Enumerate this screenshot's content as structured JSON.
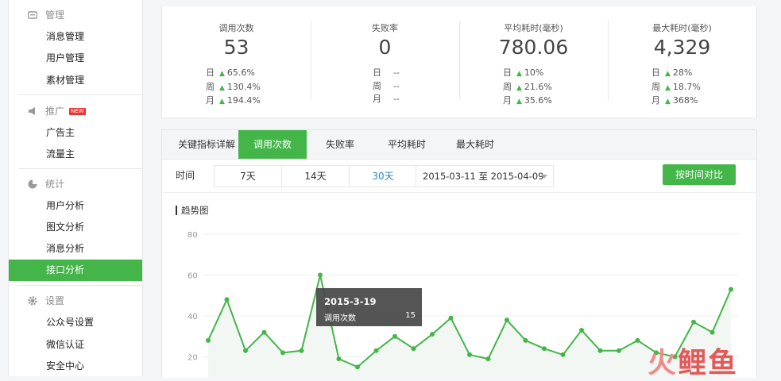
{
  "sidebar": {
    "sections": [
      {
        "icon": "management-icon",
        "title": "管理",
        "items": [
          {
            "label": "消息管理"
          },
          {
            "label": "用户管理"
          },
          {
            "label": "素材管理"
          }
        ]
      },
      {
        "icon": "megaphone-icon",
        "title": "推广",
        "badge": "NEW",
        "items": [
          {
            "label": "广告主"
          },
          {
            "label": "流量主"
          }
        ]
      },
      {
        "icon": "statistics-icon",
        "title": "统计",
        "items": [
          {
            "label": "用户分析"
          },
          {
            "label": "图文分析"
          },
          {
            "label": "消息分析"
          },
          {
            "label": "接口分析",
            "active": true
          }
        ]
      },
      {
        "icon": "settings-icon",
        "title": "设置",
        "items": [
          {
            "label": "公众号设置"
          },
          {
            "label": "微信认证"
          },
          {
            "label": "安全中心"
          }
        ]
      }
    ]
  },
  "stats": [
    {
      "title": "调用次数",
      "value": "53",
      "rows": [
        {
          "label": "日",
          "change": "65.6%"
        },
        {
          "label": "周",
          "change": "130.4%"
        },
        {
          "label": "月",
          "change": "194.4%"
        }
      ]
    },
    {
      "title": "失败率",
      "value": "0",
      "rows": [
        {
          "label": "日",
          "change": "--"
        },
        {
          "label": "周",
          "change": "--"
        },
        {
          "label": "月",
          "change": "--"
        }
      ]
    },
    {
      "title": "平均耗时(毫秒)",
      "value": "780.06",
      "rows": [
        {
          "label": "日",
          "change": "10%"
        },
        {
          "label": "周",
          "change": "21.6%"
        },
        {
          "label": "月",
          "change": "35.6%"
        }
      ]
    },
    {
      "title": "最大耗时(毫秒)",
      "value": "4,329",
      "rows": [
        {
          "label": "日",
          "change": "28%"
        },
        {
          "label": "周",
          "change": "18.7%"
        },
        {
          "label": "月",
          "change": "368%"
        }
      ]
    }
  ],
  "tabs": [
    {
      "label": "关键指标详解"
    },
    {
      "label": "调用次数",
      "active": true
    },
    {
      "label": "失败率"
    },
    {
      "label": "平均耗时"
    },
    {
      "label": "最大耗时"
    }
  ],
  "filter": {
    "time_label": "时间",
    "ranges": [
      {
        "label": "7天"
      },
      {
        "label": "14天"
      },
      {
        "label": "30天",
        "selected": true
      }
    ],
    "date_range": "2015-03-11 至 2015-04-09",
    "compare_label": "按时间对比"
  },
  "trend_title": "趋势图",
  "tooltip": {
    "date": "2015-3-19",
    "series": "调用次数",
    "value": "15"
  },
  "chart_data": {
    "type": "area",
    "ylim": [
      0,
      80
    ],
    "yticks": [
      20,
      40,
      60,
      80
    ],
    "x_range": [
      "2015-03-11",
      "2015-04-09"
    ],
    "x": [
      "2015-03-11",
      "2015-03-12",
      "2015-03-13",
      "2015-03-14",
      "2015-03-15",
      "2015-03-16",
      "2015-03-17",
      "2015-03-18",
      "2015-03-19",
      "2015-03-20",
      "2015-03-21",
      "2015-03-22",
      "2015-03-23",
      "2015-03-24",
      "2015-03-25",
      "2015-03-26",
      "2015-03-27",
      "2015-03-28",
      "2015-03-29",
      "2015-03-30",
      "2015-03-31",
      "2015-04-01",
      "2015-04-02",
      "2015-04-03",
      "2015-04-04",
      "2015-04-05",
      "2015-04-06",
      "2015-04-07",
      "2015-04-08",
      "2015-04-09"
    ],
    "series": [
      {
        "values": [
          28,
          48,
          23,
          32,
          22,
          23,
          60,
          19,
          15,
          23,
          30,
          24,
          31,
          39,
          21,
          19,
          38,
          28,
          24,
          21,
          33,
          23,
          23,
          28,
          22,
          20,
          37,
          32,
          53
        ]
      }
    ],
    "color": "#44b549"
  },
  "watermark": {
    "part1": "火",
    "part2": "鲤鱼"
  }
}
